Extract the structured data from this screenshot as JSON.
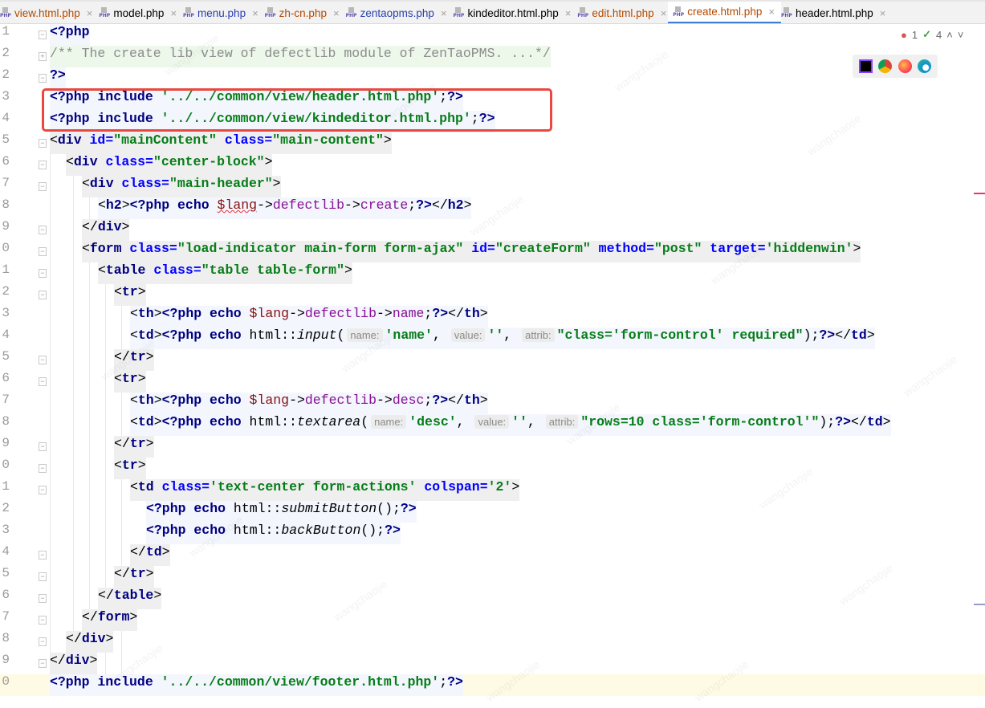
{
  "tabs": [
    {
      "label": "view.html.php",
      "color": "#b34a00",
      "active": false
    },
    {
      "label": "model.php",
      "color": "#000000",
      "active": false
    },
    {
      "label": "menu.php",
      "color": "#2a3fb0",
      "active": false
    },
    {
      "label": "zh-cn.php",
      "color": "#b34a00",
      "active": false
    },
    {
      "label": "zentaopms.php",
      "color": "#2a3fb0",
      "active": false
    },
    {
      "label": "kindeditor.html.php",
      "color": "#000000",
      "active": false
    },
    {
      "label": "edit.html.php",
      "color": "#b34a00",
      "active": false
    },
    {
      "label": "create.html.php",
      "color": "#b34a00",
      "active": true
    },
    {
      "label": "header.html.php",
      "color": "#000000",
      "active": false
    }
  ],
  "file_icon_text": "PHP",
  "close_glyph": "×",
  "inspections": {
    "errors": "1",
    "warnings": "4"
  },
  "browsers": [
    "phpstorm",
    "chrome",
    "firefox",
    "edge"
  ],
  "watermark": "wangchaojie",
  "lines": [
    {
      "n": "1",
      "i": 0,
      "bg": "php",
      "fold": "−",
      "tk": [
        [
          "k",
          "<?php"
        ]
      ]
    },
    {
      "n": "2",
      "i": 0,
      "bg": "cm",
      "fold": "+",
      "tk": [
        [
          "c",
          "/** The create lib view of defectlib module of ZenTaoPMS. ...*/"
        ]
      ]
    },
    {
      "n": "2",
      "i": 0,
      "bg": "php",
      "fold": "−",
      "tk": [
        [
          "k",
          "?>"
        ]
      ]
    },
    {
      "n": "3",
      "i": 0,
      "bg": "php",
      "tk": [
        [
          "k",
          "<?php include "
        ],
        [
          "s",
          "'../../common/view/header.html.php'"
        ],
        [
          "n",
          ";"
        ],
        [
          "k",
          "?>"
        ]
      ]
    },
    {
      "n": "4",
      "i": 0,
      "bg": "php",
      "tk": [
        [
          "k",
          "<?php include "
        ],
        [
          "s",
          "'../../common/view/kindeditor.html.php'"
        ],
        [
          "n",
          ";"
        ],
        [
          "k",
          "?>"
        ]
      ]
    },
    {
      "n": "5",
      "i": 0,
      "bg": "html",
      "fold": "−",
      "tk": [
        [
          "p",
          "<"
        ],
        [
          "t",
          "div "
        ],
        [
          "a",
          "id="
        ],
        [
          "v",
          "\"mainContent\" "
        ],
        [
          "a",
          "class="
        ],
        [
          "v",
          "\"main-content\""
        ],
        [
          "p",
          ">"
        ]
      ]
    },
    {
      "n": "6",
      "i": 1,
      "bg": "html",
      "fold": "−",
      "tk": [
        [
          "p",
          "<"
        ],
        [
          "t",
          "div "
        ],
        [
          "a",
          "class="
        ],
        [
          "v",
          "\"center-block\""
        ],
        [
          "p",
          ">"
        ]
      ]
    },
    {
      "n": "7",
      "i": 2,
      "bg": "html",
      "fold": "−",
      "tk": [
        [
          "p",
          "<"
        ],
        [
          "t",
          "div "
        ],
        [
          "a",
          "class="
        ],
        [
          "v",
          "\"main-header\""
        ],
        [
          "p",
          ">"
        ]
      ]
    },
    {
      "n": "8",
      "i": 3,
      "bg": "php",
      "tk": [
        [
          "p",
          "<"
        ],
        [
          "t",
          "h2"
        ],
        [
          "p",
          ">"
        ],
        [
          "k",
          "<?php echo "
        ],
        [
          "var",
          "$lang"
        ],
        [
          "n",
          "->"
        ],
        [
          "f",
          "defectlib"
        ],
        [
          "n",
          "->"
        ],
        [
          "f",
          "create"
        ],
        [
          "n",
          ";"
        ],
        [
          "k",
          "?>"
        ],
        [
          "p",
          "</"
        ],
        [
          "t",
          "h2"
        ],
        [
          "p",
          ">"
        ]
      ]
    },
    {
      "n": "9",
      "i": 2,
      "bg": "html",
      "fold": "−",
      "tk": [
        [
          "p",
          "</"
        ],
        [
          "t",
          "div"
        ],
        [
          "p",
          ">"
        ]
      ]
    },
    {
      "n": "0",
      "i": 2,
      "bg": "html",
      "fold": "−",
      "tk": [
        [
          "p",
          "<"
        ],
        [
          "t",
          "form "
        ],
        [
          "a",
          "class="
        ],
        [
          "v",
          "\"load-indicator main-form form-ajax\" "
        ],
        [
          "a",
          "id="
        ],
        [
          "v",
          "\"createForm\" "
        ],
        [
          "a",
          "method="
        ],
        [
          "v",
          "\"post\" "
        ],
        [
          "a",
          "target="
        ],
        [
          "v",
          "'hiddenwin'"
        ],
        [
          "p",
          ">"
        ]
      ]
    },
    {
      "n": "1",
      "i": 3,
      "bg": "html",
      "fold": "−",
      "tk": [
        [
          "p",
          "<"
        ],
        [
          "t",
          "table "
        ],
        [
          "a",
          "class="
        ],
        [
          "v",
          "\"table table-form\""
        ],
        [
          "p",
          ">"
        ]
      ]
    },
    {
      "n": "2",
      "i": 4,
      "bg": "html",
      "fold": "−",
      "tk": [
        [
          "p",
          "<"
        ],
        [
          "t",
          "tr"
        ],
        [
          "p",
          ">"
        ]
      ]
    },
    {
      "n": "3",
      "i": 5,
      "bg": "php",
      "tk": [
        [
          "p",
          "<"
        ],
        [
          "t",
          "th"
        ],
        [
          "p",
          ">"
        ],
        [
          "k",
          "<?php echo "
        ],
        [
          "var2",
          "$lang"
        ],
        [
          "n",
          "->"
        ],
        [
          "f",
          "defectlib"
        ],
        [
          "n",
          "->"
        ],
        [
          "f",
          "name"
        ],
        [
          "n",
          ";"
        ],
        [
          "k",
          "?>"
        ],
        [
          "p",
          "</"
        ],
        [
          "t",
          "th"
        ],
        [
          "p",
          ">"
        ]
      ]
    },
    {
      "n": "4",
      "i": 5,
      "bg": "php",
      "tk": [
        [
          "p",
          "<"
        ],
        [
          "t",
          "td"
        ],
        [
          "p",
          ">"
        ],
        [
          "k",
          "<?php echo "
        ],
        [
          "n",
          "html::"
        ],
        [
          "fn",
          "input"
        ],
        [
          "n",
          "("
        ],
        [
          "h",
          "name:"
        ],
        [
          "s",
          "'name'"
        ],
        [
          "n",
          ", "
        ],
        [
          "h",
          "value:"
        ],
        [
          "s",
          "''"
        ],
        [
          "n",
          ", "
        ],
        [
          "h",
          "attrib:"
        ],
        [
          "s",
          "\"class='form-control' required\""
        ],
        [
          "n",
          ");"
        ],
        [
          "k",
          "?>"
        ],
        [
          "p",
          "</"
        ],
        [
          "t",
          "td"
        ],
        [
          "p",
          ">"
        ]
      ]
    },
    {
      "n": "5",
      "i": 4,
      "bg": "html",
      "fold": "−",
      "tk": [
        [
          "p",
          "</"
        ],
        [
          "t",
          "tr"
        ],
        [
          "p",
          ">"
        ]
      ]
    },
    {
      "n": "6",
      "i": 4,
      "bg": "html",
      "fold": "−",
      "tk": [
        [
          "p",
          "<"
        ],
        [
          "t",
          "tr"
        ],
        [
          "p",
          ">"
        ]
      ]
    },
    {
      "n": "7",
      "i": 5,
      "bg": "php",
      "tk": [
        [
          "p",
          "<"
        ],
        [
          "t",
          "th"
        ],
        [
          "p",
          ">"
        ],
        [
          "k",
          "<?php echo "
        ],
        [
          "var2",
          "$lang"
        ],
        [
          "n",
          "->"
        ],
        [
          "f",
          "defectlib"
        ],
        [
          "n",
          "->"
        ],
        [
          "f",
          "desc"
        ],
        [
          "n",
          ";"
        ],
        [
          "k",
          "?>"
        ],
        [
          "p",
          "</"
        ],
        [
          "t",
          "th"
        ],
        [
          "p",
          ">"
        ]
      ]
    },
    {
      "n": "8",
      "i": 5,
      "bg": "php",
      "tk": [
        [
          "p",
          "<"
        ],
        [
          "t",
          "td"
        ],
        [
          "p",
          ">"
        ],
        [
          "k",
          "<?php echo "
        ],
        [
          "n",
          "html::"
        ],
        [
          "fn",
          "textarea"
        ],
        [
          "n",
          "("
        ],
        [
          "h",
          "name:"
        ],
        [
          "s",
          "'desc'"
        ],
        [
          "n",
          ", "
        ],
        [
          "h",
          "value:"
        ],
        [
          "s",
          "''"
        ],
        [
          "n",
          ", "
        ],
        [
          "h",
          "attrib:"
        ],
        [
          "s",
          "\"rows=10 class='form-control'\""
        ],
        [
          "n",
          ");"
        ],
        [
          "k",
          "?>"
        ],
        [
          "p",
          "</"
        ],
        [
          "t",
          "td"
        ],
        [
          "p",
          ">"
        ]
      ]
    },
    {
      "n": "9",
      "i": 4,
      "bg": "html",
      "fold": "−",
      "tk": [
        [
          "p",
          "</"
        ],
        [
          "t",
          "tr"
        ],
        [
          "p",
          ">"
        ]
      ]
    },
    {
      "n": "0",
      "i": 4,
      "bg": "html",
      "fold": "−",
      "tk": [
        [
          "p",
          "<"
        ],
        [
          "t",
          "tr"
        ],
        [
          "p",
          ">"
        ]
      ]
    },
    {
      "n": "1",
      "i": 5,
      "bg": "html",
      "fold": "−",
      "tk": [
        [
          "p",
          "<"
        ],
        [
          "t",
          "td "
        ],
        [
          "a",
          "class="
        ],
        [
          "v",
          "'text-center form-actions' "
        ],
        [
          "a",
          "colspan="
        ],
        [
          "v",
          "'2'"
        ],
        [
          "p",
          ">"
        ]
      ]
    },
    {
      "n": "2",
      "i": 6,
      "bg": "php",
      "tk": [
        [
          "k",
          "<?php echo "
        ],
        [
          "n",
          "html::"
        ],
        [
          "fn",
          "submitButton"
        ],
        [
          "n",
          "();"
        ],
        [
          "k",
          "?>"
        ]
      ]
    },
    {
      "n": "3",
      "i": 6,
      "bg": "php",
      "tk": [
        [
          "k",
          "<?php echo "
        ],
        [
          "n",
          "html::"
        ],
        [
          "fn",
          "backButton"
        ],
        [
          "n",
          "();"
        ],
        [
          "k",
          "?>"
        ]
      ]
    },
    {
      "n": "4",
      "i": 5,
      "bg": "html",
      "fold": "−",
      "tk": [
        [
          "p",
          "</"
        ],
        [
          "t",
          "td"
        ],
        [
          "p",
          ">"
        ]
      ]
    },
    {
      "n": "5",
      "i": 4,
      "bg": "html",
      "fold": "−",
      "tk": [
        [
          "p",
          "</"
        ],
        [
          "t",
          "tr"
        ],
        [
          "p",
          ">"
        ]
      ]
    },
    {
      "n": "6",
      "i": 3,
      "bg": "html",
      "fold": "−",
      "tk": [
        [
          "p",
          "</"
        ],
        [
          "t",
          "table"
        ],
        [
          "p",
          ">"
        ]
      ]
    },
    {
      "n": "7",
      "i": 2,
      "bg": "html",
      "fold": "−",
      "tk": [
        [
          "p",
          "</"
        ],
        [
          "t",
          "form"
        ],
        [
          "p",
          ">"
        ]
      ]
    },
    {
      "n": "8",
      "i": 1,
      "bg": "html",
      "fold": "−",
      "tk": [
        [
          "p",
          "</"
        ],
        [
          "t",
          "div"
        ],
        [
          "p",
          ">"
        ]
      ]
    },
    {
      "n": "9",
      "i": 0,
      "bg": "html",
      "fold": "−",
      "tk": [
        [
          "p",
          "</"
        ],
        [
          "t",
          "div"
        ],
        [
          "p",
          ">"
        ]
      ]
    },
    {
      "n": "0",
      "i": 0,
      "bg": "php",
      "cur": true,
      "tk": [
        [
          "k",
          "<?php include "
        ],
        [
          "s",
          "'../../common/view/footer.html.php'"
        ],
        [
          "n",
          ";"
        ],
        [
          "k",
          "?>"
        ]
      ]
    }
  ]
}
